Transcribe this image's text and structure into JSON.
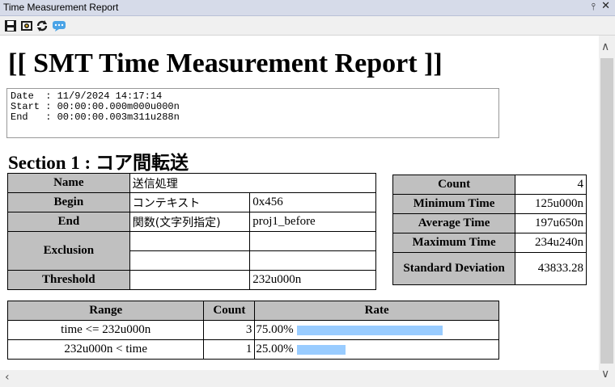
{
  "window": {
    "title": "Time Measurement Report",
    "pin_glyph": "ᵽ",
    "close_glyph": "×"
  },
  "toolbar": {
    "icons": [
      "save-icon",
      "camera-icon",
      "refresh-icon",
      "comment-icon"
    ]
  },
  "report": {
    "title": "[[ SMT Time Measurement Report ]]",
    "info": {
      "date_label": "Date  : 11/9/2024 14:17:14",
      "start_label": "Start : 00:00:00.000m000u000n",
      "end_label": "End   : 00:00:00.003m311u288n"
    },
    "section_title": "Section 1 : コア間転送",
    "details": {
      "name_label": "Name",
      "name_value": "送信処理",
      "begin_label": "Begin",
      "begin_value": "コンテキスト",
      "begin_addr": "0x456",
      "end_label": "End",
      "end_value": "関数(文字列指定)",
      "end_addr": "proj1_before",
      "exclusion_label": "Exclusion",
      "threshold_label": "Threshold",
      "threshold_value": "232u000n"
    },
    "stats": {
      "count_label": "Count",
      "count_value": "4",
      "min_label": "Minimum Time",
      "min_value": "125u000n",
      "avg_label": "Average Time",
      "avg_value": "197u650n",
      "max_label": "Maximum Time",
      "max_value": "234u240n",
      "std_label": "Standard Deviation",
      "std_value": "43833.28"
    },
    "distribution": {
      "headers": {
        "range": "Range",
        "count": "Count",
        "rate": "Rate"
      },
      "rows": [
        {
          "range": "time <= 232u000n",
          "count": "3",
          "rate": "75.00%",
          "fraction": 0.75
        },
        {
          "range": "232u000n < time",
          "count": "1",
          "rate": "25.00%",
          "fraction": 0.25
        }
      ]
    }
  },
  "colors": {
    "header_bg": "#c0c0c0",
    "bar": "#99ccff"
  }
}
